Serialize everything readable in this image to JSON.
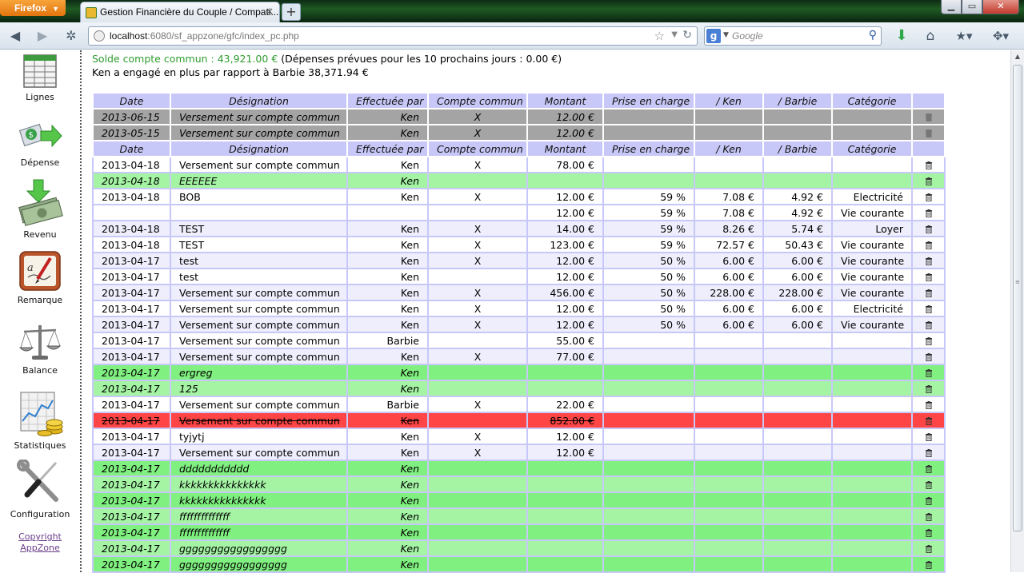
{
  "browser": {
    "menu_button": "Firefox",
    "tab_title": "Gestion Financière du Couple / Compati...",
    "new_tab": "+",
    "url_host": "localhost",
    "url_rest": ":6080/sf_appzone/gfc/index_pc.php",
    "search_placeholder": "Google"
  },
  "sidebar": {
    "items": [
      {
        "label": "Lignes",
        "icon": "table-grid-icon"
      },
      {
        "label": "Dépense",
        "icon": "money-out-arrow-icon"
      },
      {
        "label": "Revenu",
        "icon": "money-in-arrow-icon"
      },
      {
        "label": "Remarque",
        "icon": "notepad-pen-icon"
      },
      {
        "label": "Balance",
        "icon": "scales-icon"
      },
      {
        "label": "Statistiques",
        "icon": "chart-coins-icon"
      },
      {
        "label": "Configuration",
        "icon": "wrench-screwdriver-icon"
      }
    ],
    "copyright_line1": "Copyright",
    "copyright_line2": "AppZone"
  },
  "summary": {
    "solde_label": "Solde compte commun : 43,921.00 €",
    "solde_rest": " (Dépenses prévues pour les 10 prochains jours : 0.00 €)",
    "engage": "Ken a engagé en plus par rapport à Barbie 38,371.94 €"
  },
  "columns": [
    "Date",
    "Désignation",
    "Effectuée par",
    "Compte commun",
    "Montant",
    "Prise en charge",
    "/ Ken",
    "/ Barbie",
    "Catégorie"
  ],
  "planned_rows": [
    {
      "date": "2013-06-15",
      "des": "Versement sur compte commun",
      "eff": "Ken",
      "cc": "X",
      "mt": "12.00 €",
      "pc": "",
      "ken": "",
      "bar": "",
      "cat": ""
    },
    {
      "date": "2013-05-15",
      "des": "Versement sur compte commun",
      "eff": "Ken",
      "cc": "X",
      "mt": "12.00 €",
      "pc": "",
      "ken": "",
      "bar": "",
      "cat": ""
    }
  ],
  "rows": [
    {
      "style": "white",
      "date": "2013-04-18",
      "des": "Versement sur compte commun",
      "eff": "Ken",
      "cc": "X",
      "mt": "78.00 €",
      "pc": "",
      "ken": "",
      "bar": "",
      "cat": ""
    },
    {
      "style": "green2",
      "date": "2013-04-18",
      "des": "EEEEEE",
      "eff": "Ken",
      "cc": "",
      "mt": "",
      "pc": "",
      "ken": "",
      "bar": "",
      "cat": ""
    },
    {
      "style": "white",
      "date": "2013-04-18",
      "des": "BOB",
      "eff": "Ken",
      "cc": "X",
      "mt": "12.00 €",
      "pc": "59 %",
      "ken": "7.08 €",
      "bar": "4.92 €",
      "cat": "Electricité"
    },
    {
      "style": "white",
      "date": "",
      "des": "",
      "eff": "",
      "cc": "",
      "mt": "12.00 €",
      "pc": "59 %",
      "ken": "7.08 €",
      "bar": "4.92 €",
      "cat": "Vie courante"
    },
    {
      "style": "lav",
      "date": "2013-04-18",
      "des": "TEST",
      "eff": "Ken",
      "cc": "X",
      "mt": "14.00 €",
      "pc": "59 %",
      "ken": "8.26 €",
      "bar": "5.74 €",
      "cat": "Loyer"
    },
    {
      "style": "white",
      "date": "2013-04-18",
      "des": "TEST",
      "eff": "Ken",
      "cc": "X",
      "mt": "123.00 €",
      "pc": "59 %",
      "ken": "72.57 €",
      "bar": "50.43 €",
      "cat": "Vie courante"
    },
    {
      "style": "lav",
      "date": "2013-04-17",
      "des": "test",
      "eff": "Ken",
      "cc": "X",
      "mt": "12.00 €",
      "pc": "50 %",
      "ken": "6.00 €",
      "bar": "6.00 €",
      "cat": "Vie courante"
    },
    {
      "style": "white",
      "date": "2013-04-17",
      "des": "test",
      "eff": "Ken",
      "cc": "",
      "mt": "12.00 €",
      "pc": "50 %",
      "ken": "6.00 €",
      "bar": "6.00 €",
      "cat": "Vie courante"
    },
    {
      "style": "lav",
      "date": "2013-04-17",
      "des": "Versement sur compte commun",
      "eff": "Ken",
      "cc": "X",
      "mt": "456.00 €",
      "pc": "50 %",
      "ken": "228.00 €",
      "bar": "228.00 €",
      "cat": "Vie courante"
    },
    {
      "style": "white",
      "date": "2013-04-17",
      "des": "Versement sur compte commun",
      "eff": "Ken",
      "cc": "X",
      "mt": "12.00 €",
      "pc": "50 %",
      "ken": "6.00 €",
      "bar": "6.00 €",
      "cat": "Electricité"
    },
    {
      "style": "lav",
      "date": "2013-04-17",
      "des": "Versement sur compte commun",
      "eff": "Ken",
      "cc": "X",
      "mt": "12.00 €",
      "pc": "50 %",
      "ken": "6.00 €",
      "bar": "6.00 €",
      "cat": "Vie courante"
    },
    {
      "style": "white",
      "date": "2013-04-17",
      "des": "Versement sur compte commun",
      "eff": "Barbie",
      "cc": "",
      "mt": "55.00 €",
      "pc": "",
      "ken": "",
      "bar": "",
      "cat": ""
    },
    {
      "style": "lav",
      "date": "2013-04-17",
      "des": "Versement sur compte commun",
      "eff": "Ken",
      "cc": "X",
      "mt": "77.00 €",
      "pc": "",
      "ken": "",
      "bar": "",
      "cat": ""
    },
    {
      "style": "green1",
      "date": "2013-04-17",
      "des": "ergreg",
      "eff": "Ken",
      "cc": "",
      "mt": "",
      "pc": "",
      "ken": "",
      "bar": "",
      "cat": ""
    },
    {
      "style": "green2",
      "date": "2013-04-17",
      "des": "125",
      "eff": "Ken",
      "cc": "",
      "mt": "",
      "pc": "",
      "ken": "",
      "bar": "",
      "cat": ""
    },
    {
      "style": "white",
      "date": "2013-04-17",
      "des": "Versement sur compte commun",
      "eff": "Barbie",
      "cc": "X",
      "mt": "22.00 €",
      "pc": "",
      "ken": "",
      "bar": "",
      "cat": ""
    },
    {
      "style": "red",
      "date": "2013-04-17",
      "des": "Versement sur compte commun",
      "eff": "Ken",
      "cc": "",
      "mt": "852.00 €",
      "pc": "",
      "ken": "",
      "bar": "",
      "cat": ""
    },
    {
      "style": "white",
      "date": "2013-04-17",
      "des": "tyjytj",
      "eff": "Ken",
      "cc": "X",
      "mt": "12.00 €",
      "pc": "",
      "ken": "",
      "bar": "",
      "cat": ""
    },
    {
      "style": "lav",
      "date": "2013-04-17",
      "des": "Versement sur compte commun",
      "eff": "Ken",
      "cc": "X",
      "mt": "12.00 €",
      "pc": "",
      "ken": "",
      "bar": "",
      "cat": ""
    },
    {
      "style": "green1",
      "date": "2013-04-17",
      "des": "ddddddddddd",
      "eff": "Ken",
      "cc": "",
      "mt": "",
      "pc": "",
      "ken": "",
      "bar": "",
      "cat": ""
    },
    {
      "style": "green2",
      "date": "2013-04-17",
      "des": "kkkkkkkkkkkkkkk",
      "eff": "Ken",
      "cc": "",
      "mt": "",
      "pc": "",
      "ken": "",
      "bar": "",
      "cat": ""
    },
    {
      "style": "green1",
      "date": "2013-04-17",
      "des": "kkkkkkkkkkkkkkk",
      "eff": "Ken",
      "cc": "",
      "mt": "",
      "pc": "",
      "ken": "",
      "bar": "",
      "cat": ""
    },
    {
      "style": "green2",
      "date": "2013-04-17",
      "des": "ffffffffffffff",
      "eff": "Ken",
      "cc": "",
      "mt": "",
      "pc": "",
      "ken": "",
      "bar": "",
      "cat": ""
    },
    {
      "style": "green1",
      "date": "2013-04-17",
      "des": "ffffffffffffff",
      "eff": "Ken",
      "cc": "",
      "mt": "",
      "pc": "",
      "ken": "",
      "bar": "",
      "cat": ""
    },
    {
      "style": "green2",
      "date": "2013-04-17",
      "des": "ggggggggggggggggg",
      "eff": "Ken",
      "cc": "",
      "mt": "",
      "pc": "",
      "ken": "",
      "bar": "",
      "cat": ""
    },
    {
      "style": "green1",
      "date": "2013-04-17",
      "des": "ggggggggggggggggg",
      "eff": "Ken",
      "cc": "",
      "mt": "",
      "pc": "",
      "ken": "",
      "bar": "",
      "cat": ""
    }
  ],
  "colors": {
    "header": "#c8c8f8",
    "planned": "#a4a4a4",
    "remark_green": "#80f080",
    "remark_green_light": "#a4f4a4",
    "deleted_red": "#ff4545",
    "solde_green": "#2e9c2e"
  }
}
